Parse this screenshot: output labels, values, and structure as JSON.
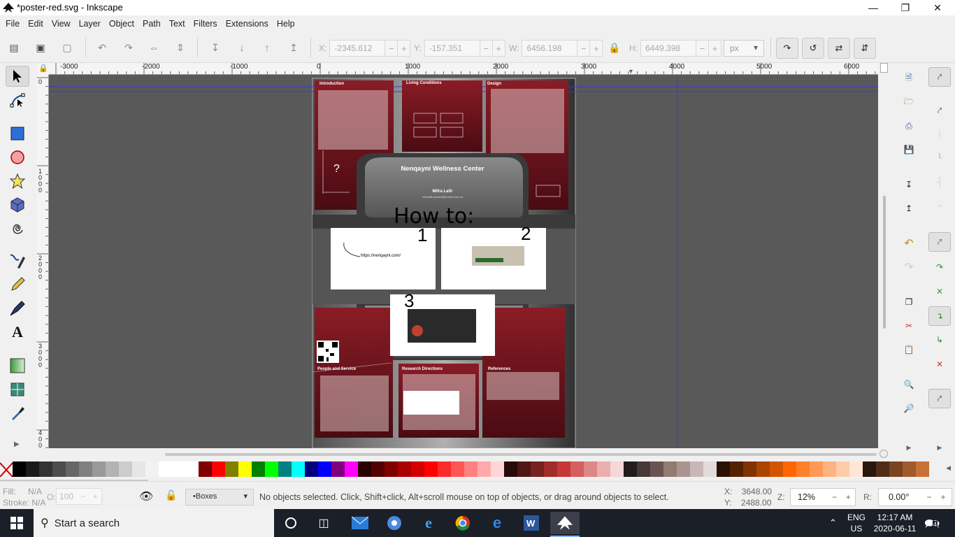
{
  "window": {
    "title": "*poster-red.svg - Inkscape"
  },
  "menu": [
    "File",
    "Edit",
    "View",
    "Layer",
    "Object",
    "Path",
    "Text",
    "Filters",
    "Extensions",
    "Help"
  ],
  "coords": {
    "x_label": "X:",
    "x_value": "-2345.612",
    "y_label": "Y:",
    "y_value": "-157.351",
    "w_label": "W:",
    "w_value": "6456.198",
    "h_label": "H:",
    "h_value": "6449.398",
    "unit": "px"
  },
  "ruler": {
    "h_ticks": [
      "-3000",
      "-2000",
      "-1000",
      "0",
      "1000",
      "2000",
      "3000",
      "4000",
      "5000",
      "6000"
    ],
    "v_ticks": [
      "0",
      "1 0 0 0",
      "2 0 0 0",
      "3 0 0 0",
      "4 0 0"
    ]
  },
  "poster": {
    "intro": "Introduction",
    "living": "Living Conditions",
    "design": "Design",
    "center_title": "Nenqayni Wellness Center",
    "author": "Mifra Lafir",
    "email": "mifralafir.student@email.unbc.ca",
    "question": "?",
    "howto": "How to:",
    "step1": "1",
    "step2": "2",
    "step3": "3",
    "url": "https://nenqayni.com/",
    "people": "People and Service",
    "research": "Research Directions",
    "references": "References"
  },
  "status": {
    "fill_label": "Fill:",
    "fill_value": "N/A",
    "stroke_label": "Stroke:",
    "stroke_value": "N/A",
    "opacity_label": "O:",
    "opacity_value": "100",
    "layer": "•Boxes",
    "message": "No objects selected. Click, Shift+click, Alt+scroll mouse on top of objects, or drag around objects to select.",
    "cx_label": "X:",
    "cx_value": "3648.00",
    "cy_label": "Y:",
    "cy_value": "2488.00",
    "zoom_label": "Z:",
    "zoom_value": "12%",
    "rot_label": "R:",
    "rot_value": "0.00°"
  },
  "taskbar": {
    "search_placeholder": "Start a search",
    "lang1": "ENG",
    "lang2": "US",
    "time": "12:17 AM",
    "date": "2020-06-11",
    "notif_count": "4"
  },
  "palette": [
    "#000000",
    "#1a1a1a",
    "#333333",
    "#4d4d4d",
    "#666666",
    "#808080",
    "#999999",
    "#b3b3b3",
    "#cccccc",
    "#e6e6e6",
    "#f2f2f2",
    "#ffffff",
    "#ffffff",
    "#ffffff",
    "#800000",
    "#ff0000",
    "#808000",
    "#ffff00",
    "#008000",
    "#00ff00",
    "#008080",
    "#00ffff",
    "#000080",
    "#0000ff",
    "#800080",
    "#ff00ff",
    "#2b0000",
    "#550000",
    "#800000",
    "#aa0000",
    "#d40000",
    "#ff0000",
    "#ff2a2a",
    "#ff5555",
    "#ff8080",
    "#ffaaaa",
    "#ffd5d5",
    "#280b0b",
    "#501616",
    "#782121",
    "#a02c2c",
    "#c83737",
    "#d35f5f",
    "#de8787",
    "#e9afaf",
    "#f4d7d7",
    "#241c1c",
    "#483737",
    "#6c5353",
    "#917c6f",
    "#ac9393",
    "#c8b7b7",
    "#e3dbdb",
    "#2b1100",
    "#552200",
    "#803300",
    "#aa4400",
    "#d45500",
    "#ff6600",
    "#ff7f2a",
    "#ff9955",
    "#ffb380",
    "#ffccaa",
    "#ffe6d5",
    "#28170b",
    "#502d16",
    "#784421",
    "#a05a2c",
    "#c87137"
  ]
}
